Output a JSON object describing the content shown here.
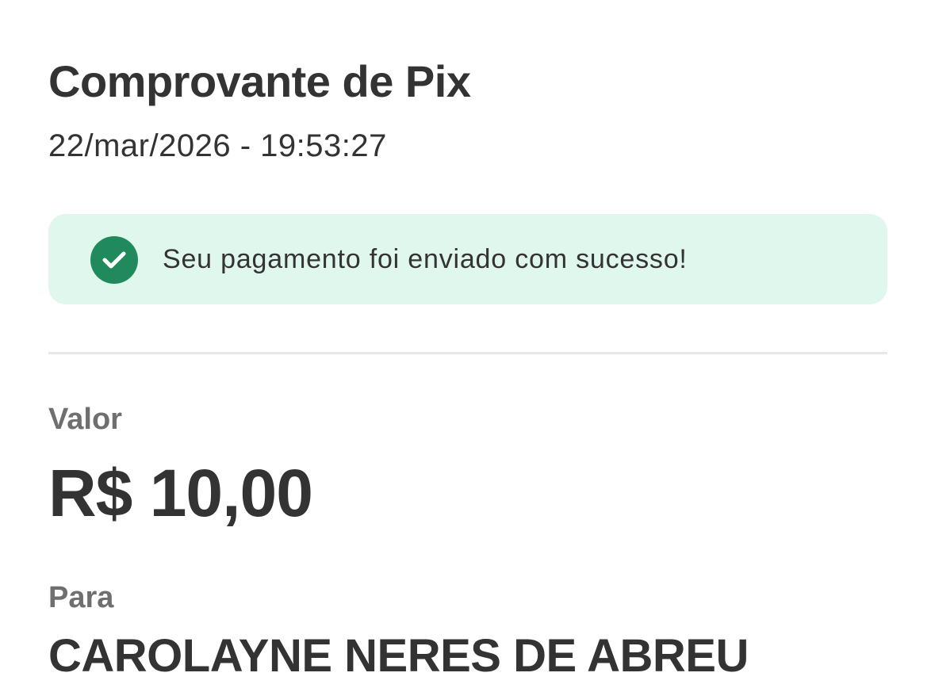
{
  "receipt": {
    "title": "Comprovante de Pix",
    "datetime": "22/mar/2026 - 19:53:27"
  },
  "status": {
    "icon": "check-circle-icon",
    "message": "Seu pagamento foi enviado com sucesso!",
    "background_color": "#e0f7ee",
    "icon_color": "#218a5c"
  },
  "amount": {
    "label": "Valor",
    "value": "R$ 10,00"
  },
  "recipient": {
    "label": "Para",
    "name": "CAROLAYNE NERES DE ABREU"
  }
}
